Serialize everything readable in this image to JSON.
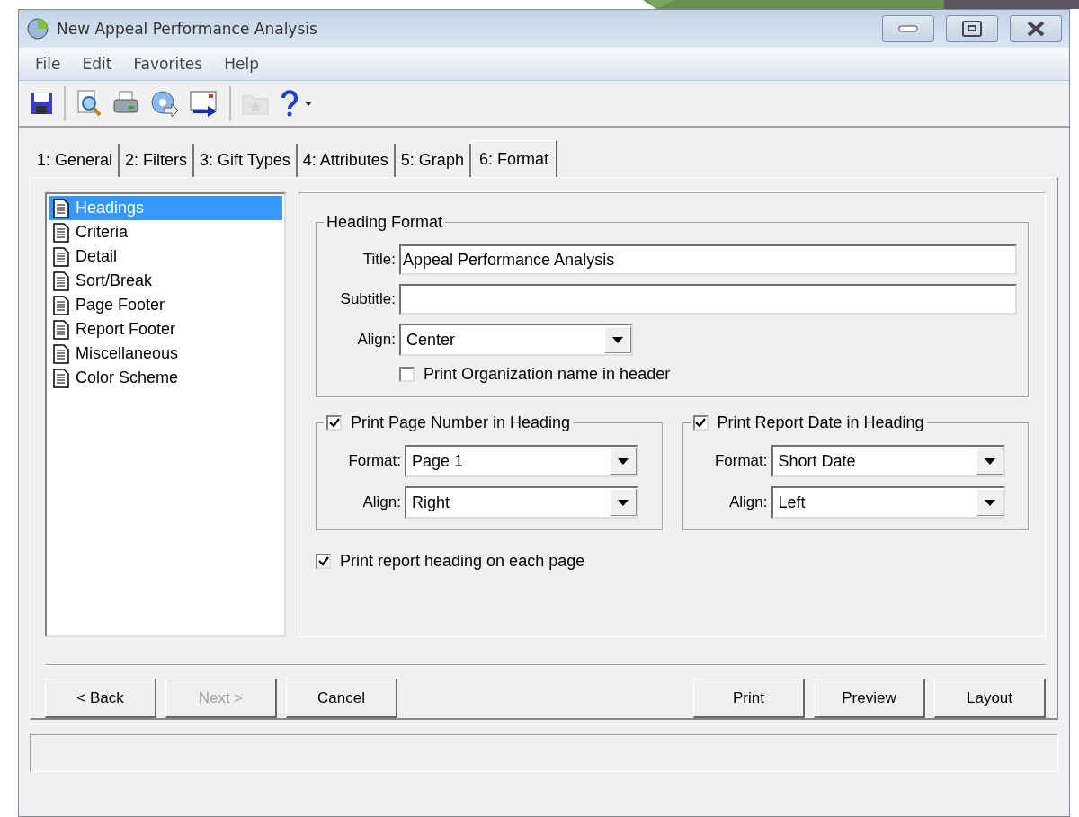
{
  "window": {
    "title": "New Appeal Performance Analysis"
  },
  "menu": [
    "File",
    "Edit",
    "Favorites",
    "Help"
  ],
  "toolbar": [
    {
      "kind": "save",
      "disabled": false
    },
    {
      "kind": "sep"
    },
    {
      "kind": "preview",
      "disabled": false
    },
    {
      "kind": "print",
      "disabled": false
    },
    {
      "kind": "export",
      "disabled": false
    },
    {
      "kind": "send",
      "disabled": false
    },
    {
      "kind": "sep"
    },
    {
      "kind": "favorite",
      "disabled": true
    },
    {
      "kind": "help",
      "disabled": false
    }
  ],
  "tabs": [
    {
      "label": "1: General",
      "selected": false
    },
    {
      "label": "2: Filters",
      "selected": false
    },
    {
      "label": "3: Gift Types",
      "selected": false
    },
    {
      "label": "4: Attributes",
      "selected": false
    },
    {
      "label": "5: Graph",
      "selected": false
    },
    {
      "label": "6: Format",
      "selected": true
    }
  ],
  "sections": [
    {
      "label": "Headings",
      "selected": true
    },
    {
      "label": "Criteria",
      "selected": false
    },
    {
      "label": "Detail",
      "selected": false
    },
    {
      "label": "Sort/Break",
      "selected": false
    },
    {
      "label": "Page Footer",
      "selected": false
    },
    {
      "label": "Report Footer",
      "selected": false
    },
    {
      "label": "Miscellaneous",
      "selected": false
    },
    {
      "label": "Color Scheme",
      "selected": false
    }
  ],
  "heading_format": {
    "legend": "Heading Format",
    "title": {
      "label": "Title:",
      "value": "Appeal Performance Analysis"
    },
    "subtitle": {
      "label": "Subtitle:"
    },
    "align": {
      "label": "Align:",
      "value": "Center"
    },
    "print_org": {
      "label": "Print Organization name in header",
      "checked": false
    }
  },
  "groups": [
    {
      "label": "Print Page Number in Heading",
      "checked": true,
      "format": {
        "label": "Format:",
        "value": "Page 1"
      },
      "align": {
        "label": "Align:",
        "value": "Right"
      }
    },
    {
      "label": "Print Report Date in Heading",
      "checked": true,
      "format": {
        "label": "Format:",
        "value": "Short Date"
      },
      "align": {
        "label": "Align:",
        "value": "Left"
      }
    }
  ],
  "print_each_page": {
    "label": "Print report heading on each page",
    "checked": true
  },
  "buttons_left": [
    {
      "label": "< Back",
      "disabled": false
    },
    {
      "label": "Next >",
      "disabled": true
    },
    {
      "label": "Cancel",
      "disabled": false
    }
  ],
  "buttons_right": [
    {
      "label": "Print",
      "disabled": false
    },
    {
      "label": "Preview",
      "disabled": false
    },
    {
      "label": "Layout",
      "disabled": false
    }
  ]
}
